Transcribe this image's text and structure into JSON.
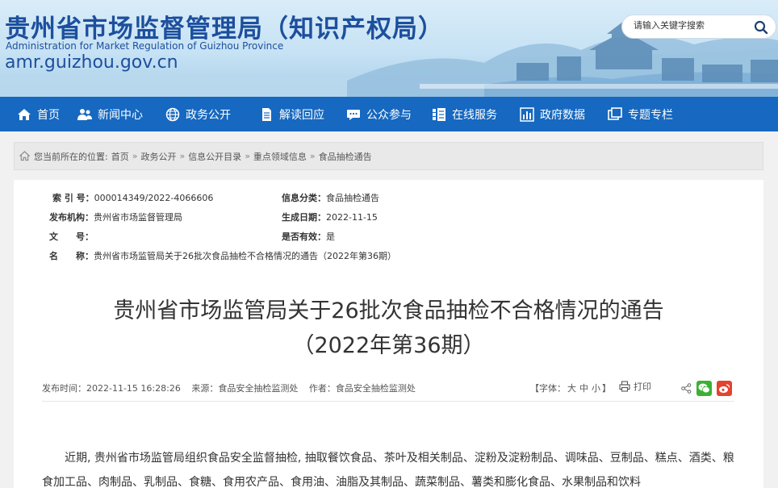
{
  "header": {
    "title_cn": "贵州省市场监督管理局（知识产权局）",
    "title_en": "Administration for Market Regulation of Guizhou Province",
    "domain": "amr.guizhou.gov.cn",
    "search_placeholder": "请输入关键字搜索",
    "accent_color": "#1d4f9e"
  },
  "nav": {
    "bg_color": "#1668c0",
    "items": [
      {
        "label": "首页",
        "icon": "home-icon"
      },
      {
        "label": "新闻中心",
        "icon": "people-icon"
      },
      {
        "label": "政务公开",
        "icon": "globe-icon"
      },
      {
        "label": "解读回应",
        "icon": "document-icon"
      },
      {
        "label": "公众参与",
        "icon": "chat-icon"
      },
      {
        "label": "在线服务",
        "icon": "list-icon"
      },
      {
        "label": "政府数据",
        "icon": "bar-chart-icon"
      },
      {
        "label": "专题专栏",
        "icon": "windows-icon"
      }
    ]
  },
  "breadcrumb": {
    "prefix": "您当前所在的位置:",
    "items": [
      "首页",
      "政务公开",
      "信息公开目录",
      "重点领域信息",
      "食品抽检通告"
    ]
  },
  "meta": {
    "index_label": "索 引 号：",
    "index_value": "000014349/2022-4066606",
    "category_label": "信息分类：",
    "category_value": "食品抽检通告",
    "publisher_label": "发布机构：",
    "publisher_value": "贵州省市场监督管理局",
    "date_label": "生成日期：",
    "date_value": "2022-11-15",
    "docno_label": "文　　号：",
    "docno_value": "",
    "valid_label": "是否有效：",
    "valid_value": "是",
    "name_label": "名　　称：",
    "name_value": "贵州省市场监管局关于26批次食品抽检不合格情况的通告（2022年第36期）"
  },
  "article": {
    "title_line1": "贵州省市场监管局关于26批次食品抽检不合格情况的通告",
    "title_line2": "（2022年第36期）",
    "publish_time": "发布时间：2022-11-15 16:28:26",
    "source": "来源：食品安全抽检监测处",
    "author": "作者：食品安全抽检监测处",
    "font_prefix": "【字体：",
    "font_large": "大",
    "font_medium": "中",
    "font_small": "小",
    "font_suffix": "】",
    "print_label": "打印",
    "body": "近期, 贵州省市场监管局组织食品安全监督抽检, 抽取餐饮食品、茶叶及相关制品、淀粉及淀粉制品、调味品、豆制品、糕点、酒类、粮食加工品、肉制品、乳制品、食糖、食用农产品、食用油、油脂及其制品、蔬菜制品、薯类和膨化食品、水果制品和饮料"
  }
}
